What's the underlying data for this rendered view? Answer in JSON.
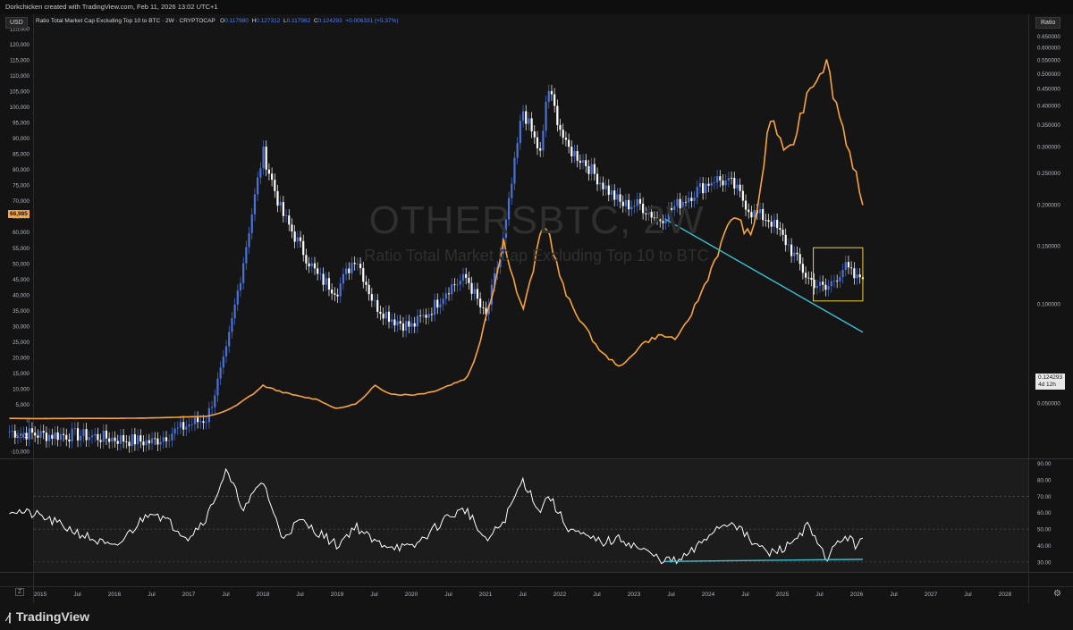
{
  "attribution": "Dorkchicken created with TradingView.com, Feb 11, 2026 13:02 UTC+1",
  "header": {
    "symbol_title": "Ratio Total Market Cap Excluding Top 10 to BTC · 2W · CRYPTOCAP",
    "o_label": "O",
    "o_value": "0.117980",
    "h_label": "H",
    "h_value": "0.127312",
    "l_label": "L",
    "l_value": "0.117962",
    "c_label": "C",
    "c_value": "0.124293",
    "change": "+0.006331 (+5.37%)"
  },
  "watermark": {
    "ticker": "OTHERSBTC, 2W",
    "name": "Ratio Total Market Cap Excluding Top 10 to BTC"
  },
  "left_scale_label": "USD",
  "right_scale_label": "Ratio",
  "last_price_badge": {
    "value": "66,985",
    "color": "#f7a43a"
  },
  "last_ratio_badge": {
    "value": "0.124293",
    "countdown": "4d 12h"
  },
  "branding": "TradingView",
  "colors": {
    "background": "#131313",
    "candle_up": "#4a72d8",
    "candle_down": "#ffffff",
    "overlay_line": "#f7a43a",
    "trendline": "#3bbfd0",
    "highlight_box": "#f0d040",
    "rsi_line": "#ffffff"
  },
  "chart_data": [
    {
      "type": "line",
      "name": "main",
      "x": [
        "2014-08",
        "2015-01",
        "2015-07",
        "2016-01",
        "2016-07",
        "2017-01",
        "2017-04",
        "2017-07",
        "2017-10",
        "2018-01",
        "2018-04",
        "2018-07",
        "2018-10",
        "2019-01",
        "2019-04",
        "2019-07",
        "2019-10",
        "2020-01",
        "2020-04",
        "2020-07",
        "2020-10",
        "2021-01",
        "2021-04",
        "2021-07",
        "2021-10",
        "2021-11",
        "2022-02",
        "2022-05",
        "2022-08",
        "2022-11",
        "2023-02",
        "2023-05",
        "2023-08",
        "2023-11",
        "2024-02",
        "2024-05",
        "2024-08",
        "2024-11",
        "2025-02",
        "2025-05",
        "2025-08",
        "2025-11",
        "2026-01",
        "2026-02"
      ],
      "left_axis": {
        "label": "USD",
        "ylim": [
          -10000,
          125000
        ],
        "ticks": [
          "125,000",
          "120,000",
          "115,000",
          "110,000",
          "105,000",
          "100,000",
          "95,000",
          "90,000",
          "85,000",
          "80,000",
          "75,000",
          "70,000",
          "65,000",
          "60,000",
          "55,000",
          "50,000",
          "45,000",
          "40,000",
          "35,000",
          "30,000",
          "25,000",
          "20,000",
          "15,000",
          "10,000",
          "5,000",
          "0",
          "-5,000",
          "-10,000"
        ]
      },
      "right_axis": {
        "label": "Ratio",
        "scale": "log",
        "ylim": [
          0.035,
          0.72
        ],
        "ticks": [
          "0.650000",
          "0.600000",
          "0.550000",
          "0.500000",
          "0.450000",
          "0.400000",
          "0.350000",
          "0.300000",
          "0.250000",
          "0.200000",
          "0.150000",
          "0.100000",
          "0.050000"
        ]
      },
      "series": [
        {
          "name": "OTHERSBTC",
          "axis": "right",
          "style": "candles",
          "values": [
            0.041,
            0.04,
            0.04,
            0.039,
            0.038,
            0.043,
            0.045,
            0.07,
            0.14,
            0.29,
            0.19,
            0.15,
            0.12,
            0.11,
            0.14,
            0.1,
            0.09,
            0.085,
            0.095,
            0.112,
            0.12,
            0.09,
            0.16,
            0.39,
            0.28,
            0.46,
            0.3,
            0.27,
            0.23,
            0.2,
            0.2,
            0.18,
            0.2,
            0.22,
            0.24,
            0.23,
            0.19,
            0.18,
            0.15,
            0.12,
            0.11,
            0.13,
            0.118,
            0.124
          ]
        },
        {
          "name": "BTC",
          "axis": "left",
          "style": "line",
          "values": [
            500,
            450,
            500,
            500,
            650,
            1000,
            1200,
            3000,
            6500,
            11000,
            9000,
            7500,
            6500,
            3600,
            5200,
            11000,
            8200,
            8000,
            8800,
            11000,
            13500,
            33000,
            58000,
            35000,
            61000,
            62000,
            40000,
            30000,
            21000,
            17000,
            24000,
            27000,
            26000,
            37000,
            51000,
            66000,
            58000,
            97000,
            84000,
            105000,
            115000,
            92000,
            78000,
            66985
          ]
        }
      ],
      "annotations": [
        {
          "kind": "trendline",
          "from": {
            "x": "2023-06",
            "y": 0.181
          },
          "to": {
            "x": "2026-02",
            "y": 0.082
          }
        },
        {
          "kind": "rectangle",
          "x1": "2025-06",
          "x2": "2026-02",
          "y1": 0.102,
          "y2": 0.148
        }
      ],
      "grid": false
    },
    {
      "type": "line",
      "name": "rsi",
      "x": [
        "2014-08",
        "2015-01",
        "2015-07",
        "2016-01",
        "2016-07",
        "2017-01",
        "2017-04",
        "2017-07",
        "2017-10",
        "2018-01",
        "2018-04",
        "2018-07",
        "2018-10",
        "2019-01",
        "2019-04",
        "2019-07",
        "2019-10",
        "2020-01",
        "2020-04",
        "2020-07",
        "2020-10",
        "2021-01",
        "2021-04",
        "2021-07",
        "2021-10",
        "2021-11",
        "2022-02",
        "2022-05",
        "2022-08",
        "2022-11",
        "2023-02",
        "2023-05",
        "2023-08",
        "2023-11",
        "2024-02",
        "2024-05",
        "2024-08",
        "2024-11",
        "2025-02",
        "2025-05",
        "2025-08",
        "2025-11",
        "2026-01",
        "2026-02"
      ],
      "ylim": [
        25,
        92
      ],
      "ticks": [
        "90.00",
        "80.00",
        "70.00",
        "60.00",
        "50.00",
        "40.00",
        "30.00"
      ],
      "reference_lines": [
        70,
        50,
        30
      ],
      "series": [
        {
          "name": "RSI",
          "values": [
            62,
            58,
            48,
            38,
            62,
            45,
            58,
            85,
            62,
            80,
            45,
            55,
            48,
            40,
            52,
            42,
            40,
            38,
            48,
            58,
            62,
            42,
            55,
            80,
            60,
            72,
            52,
            45,
            42,
            44,
            38,
            32,
            30,
            38,
            50,
            55,
            42,
            35,
            40,
            52,
            32,
            46,
            40,
            47
          ]
        }
      ],
      "annotations": [
        {
          "kind": "trendline",
          "from": {
            "x": "2023-06",
            "y": 30.3
          },
          "to": {
            "x": "2026-02",
            "y": 31.6
          }
        }
      ]
    }
  ],
  "time_axis": [
    "2015",
    "Jul",
    "2016",
    "Jul",
    "2017",
    "Jul",
    "2018",
    "Jul",
    "2019",
    "Jul",
    "2020",
    "Jul",
    "2021",
    "Jul",
    "2022",
    "Jul",
    "2023",
    "Jul",
    "2024",
    "Jul",
    "2025",
    "Jul",
    "2026",
    "Jul",
    "2027",
    "Jul",
    "2028"
  ]
}
